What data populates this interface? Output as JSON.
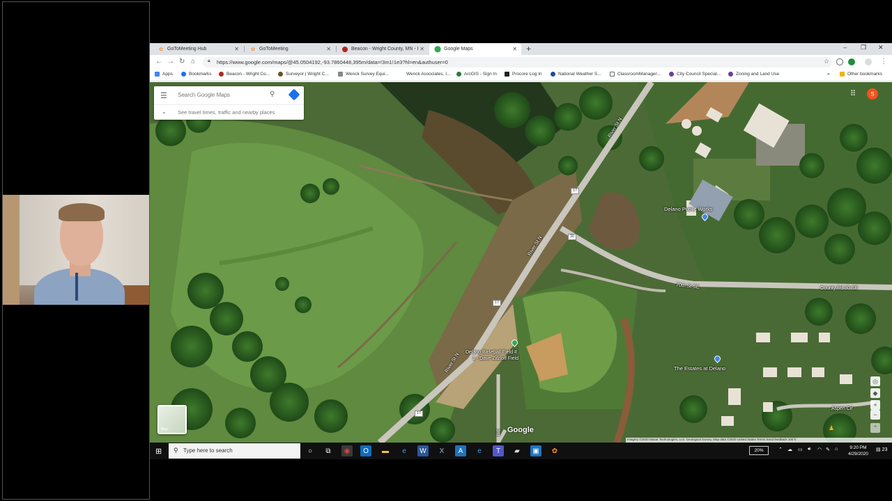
{
  "browser": {
    "tabs": [
      {
        "label": "GoToMeeting Hub",
        "icon": "gotomeeting-icon",
        "color": "#f68d2e"
      },
      {
        "label": "GoToMeeting",
        "icon": "gotomeeting-icon",
        "color": "#f68d2e"
      },
      {
        "label": "Beacon - Wright County, MN - I",
        "icon": "beacon-icon",
        "color": "#b3261e"
      },
      {
        "label": "Google Maps",
        "icon": "google-maps-icon",
        "color": "#34a853",
        "active": true
      }
    ],
    "newtab": "+",
    "window_controls": [
      "–",
      "❐",
      "✕"
    ],
    "url": "https://www.google.com/maps/@45.0504192,-93.7860448,395m/data=!3m1!1e3?hl=en&authuser=0",
    "bookmarks": [
      "Apps",
      "Bookmarks",
      "Beacon - Wright Co...",
      "Surveyor | Wright C...",
      "Wenck Survey Equi...",
      "Wenck Associates, I...",
      "ArcGIS - Sign In",
      "Procore Log In",
      "National Weather S...",
      "ClassroomManager...",
      "City Council Special...",
      "Zoning and Land Use"
    ],
    "other_bookmarks": "Other bookmarks"
  },
  "map": {
    "search_placeholder": "Search Google Maps",
    "travel_hint": "See travel times, traffic and nearby places",
    "labels": {
      "river_st_n_1": "River St N",
      "river_st_n_2": "River St N",
      "river_st_n_3": "River St N",
      "seventy_st_se": "70th St SE",
      "county_rd_30": "County Rd 30 SE",
      "public_works": "Delano Public Works",
      "baseball_field_1": "Delano Baseball Field #",
      "baseball_field_2": "1 - Dave Zitzloff Field",
      "estates": "The Estates at Delano",
      "aspen_cir": "Aspen Cir",
      "third_st": "3rd"
    },
    "shields": [
      "17",
      "30",
      "17",
      "17"
    ],
    "layers_label": "Map",
    "avatar_letter": "S",
    "logo": "Google",
    "attribution": "Imagery ©2020 Maxar Technologies, U.S. Geological Survey, Map data ©2020    United States    Terms    Send feedback    100 ft"
  },
  "taskbar": {
    "search_placeholder": "Type here to search",
    "battery": "20%",
    "time": "9:20 PM",
    "date": "4/29/2020",
    "notifications": "23"
  }
}
